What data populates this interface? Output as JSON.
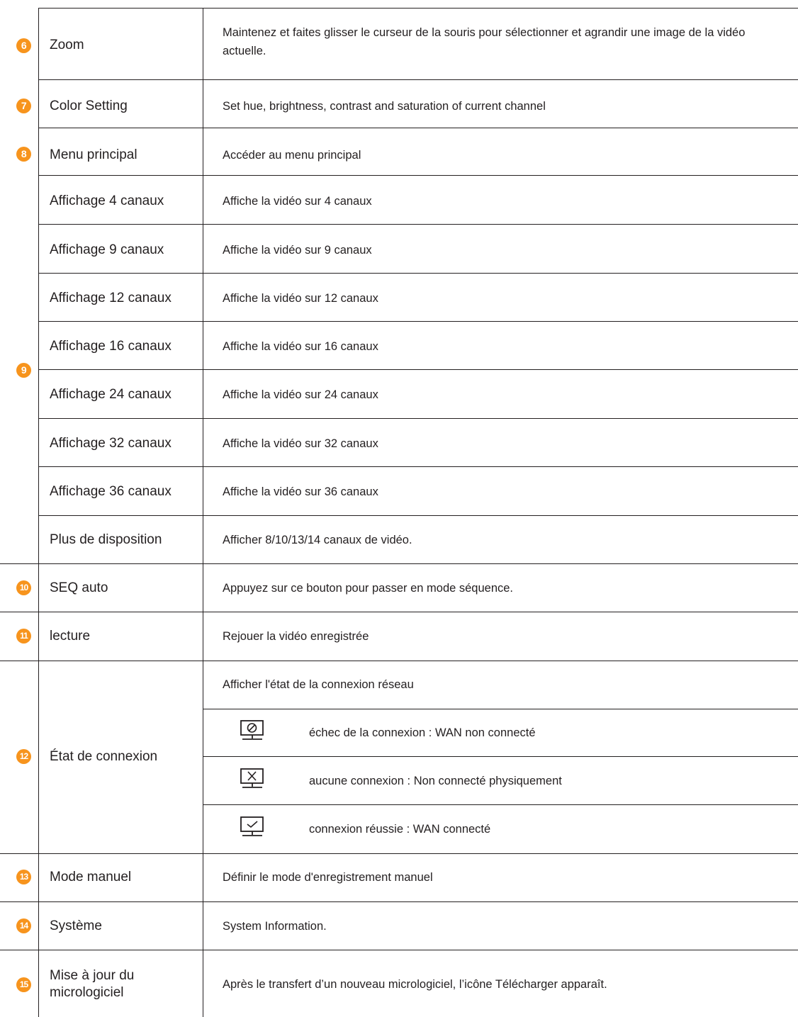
{
  "rows": [
    {
      "num": "6",
      "name": "Zoom",
      "desc": "Maintenez et faites glisser le curseur de la souris pour sélectionner et agrandir une image de la vidéo actuelle."
    },
    {
      "num": "7",
      "name": "Color Setting",
      "desc": "Set hue, brightness, contrast and saturation of current channel"
    },
    {
      "num": "8",
      "name": "Menu principal",
      "desc": "Accéder au menu principal"
    },
    {
      "num": "9",
      "name": "Affichage 4 canaux",
      "desc": "Affiche la vidéo sur 4 canaux"
    },
    {
      "name": "Affichage 9 canaux",
      "desc": "Affiche la vidéo sur 9 canaux"
    },
    {
      "name": "Affichage 12 canaux",
      "desc": "Affiche la vidéo sur 12 canaux"
    },
    {
      "name": "Affichage 16 canaux",
      "desc": "Affiche la vidéo sur 16 canaux"
    },
    {
      "name": "Affichage 24 canaux",
      "desc": "Affiche la vidéo sur 24 canaux"
    },
    {
      "name": "Affichage 32 canaux",
      "desc": "Affiche la vidéo sur 32 canaux"
    },
    {
      "name": "Affichage 36 canaux",
      "desc": "Affiche la vidéo sur 36 canaux"
    },
    {
      "name": "Plus de disposition",
      "desc": "Afficher 8/10/13/14 canaux de vidéo."
    },
    {
      "num": "10",
      "name": "SEQ auto",
      "desc": "Appuyez sur ce bouton pour passer en mode séquence."
    },
    {
      "num": "11",
      "name": "lecture",
      "desc": "Rejouer la vidéo enregistrée"
    },
    {
      "num": "12",
      "name": "État de connexion",
      "desc": "Afficher l'état de la connexion réseau",
      "sub": [
        {
          "icon": "network-failed-icon",
          "text": "échec de la connexion : WAN non connecté"
        },
        {
          "icon": "network-disconnected-icon",
          "text": "aucune connexion : Non connecté physiquement"
        },
        {
          "icon": "network-connected-icon",
          "text": "connexion réussie : WAN connecté"
        }
      ]
    },
    {
      "num": "13",
      "name": "Mode manuel",
      "desc": "Définir le mode d'enregistrement manuel"
    },
    {
      "num": "14",
      "name": "Système",
      "desc": "System Information."
    },
    {
      "num": "15",
      "name": "Mise à jour du micrologiciel",
      "desc": "Après le transfert d’un nouveau micrologiciel, l’icône Télécharger apparaît."
    }
  ],
  "colors": {
    "badge": "#f7941d",
    "text": "#231f20",
    "rule": "#231f20"
  }
}
